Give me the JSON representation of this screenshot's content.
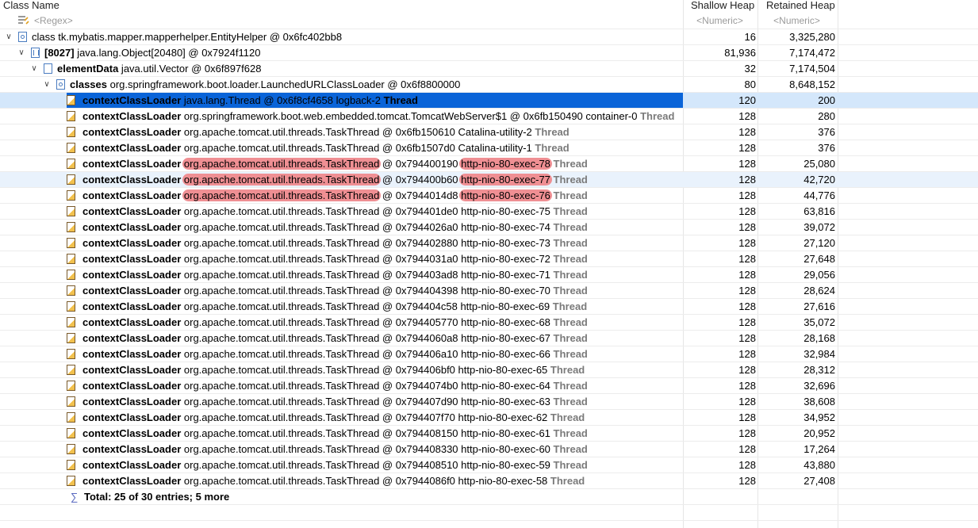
{
  "headers": {
    "class_name": "Class Name",
    "shallow_heap": "Shallow Heap",
    "retained_heap": "Retained Heap"
  },
  "filter": {
    "class_placeholder": "<Regex>",
    "shallow_placeholder": "<Numeric>",
    "retained_placeholder": "<Numeric>"
  },
  "tree": {
    "r1": {
      "name": "class tk.mybatis.mapper.mapperhelper.EntityHelper @ 0x6fc402bb8",
      "shallow": "16",
      "retained": "3,325,280"
    },
    "r2": {
      "prefix": "[8027]",
      "name": " java.lang.Object[20480] @ 0x7924f1120",
      "shallow": "81,936",
      "retained": "7,174,472"
    },
    "r3": {
      "field": "elementData",
      "name": " java.util.Vector @ 0x6f897f628",
      "shallow": "32",
      "retained": "7,174,504"
    },
    "r4": {
      "field": "classes",
      "name": " org.springframework.boot.loader.LaunchedURLClassLoader @ 0x6f8800000",
      "shallow": "80",
      "retained": "8,648,152"
    }
  },
  "field_label": "contextClassLoader",
  "thread_word": "Thread",
  "rows": [
    {
      "cls": "java.lang.Thread",
      "addr": " @ 0x6f8cf4658",
      "name": "  logback-2",
      "shallow": "120",
      "retained": "200"
    },
    {
      "cls": "org.springframework.boot.web.embedded.tomcat.TomcatWebServer$1",
      "addr": " @ 0x6fb150490",
      "name": "  container-0",
      "shallow": "128",
      "retained": "280"
    },
    {
      "cls": "org.apache.tomcat.util.threads.TaskThread",
      "addr": " @ 0x6fb150610",
      "name": "  Catalina-utility-2",
      "shallow": "128",
      "retained": "376"
    },
    {
      "cls": "org.apache.tomcat.util.threads.TaskThread",
      "addr": " @ 0x6fb1507d0",
      "name": "  Catalina-utility-1",
      "shallow": "128",
      "retained": "376"
    },
    {
      "cls": "org.apache.tomcat.util.threads.TaskThread",
      "addr": " @ 0x794400190",
      "name": "http-nio-80-exec-78",
      "shallow": "128",
      "retained": "25,080"
    },
    {
      "cls": "org.apache.tomcat.util.threads.TaskThread",
      "addr": " @ 0x794400b60",
      "name": "http-nio-80-exec-77",
      "shallow": "128",
      "retained": "42,720"
    },
    {
      "cls": "org.apache.tomcat.util.threads.TaskThread",
      "addr": " @ 0x7944014d8",
      "name": "http-nio-80-exec-76",
      "shallow": "128",
      "retained": "44,776"
    },
    {
      "cls": "org.apache.tomcat.util.threads.TaskThread",
      "addr": " @ 0x794401de0",
      "name": "  http-nio-80-exec-75",
      "shallow": "128",
      "retained": "63,816"
    },
    {
      "cls": "org.apache.tomcat.util.threads.TaskThread",
      "addr": " @ 0x7944026a0",
      "name": "  http-nio-80-exec-74",
      "shallow": "128",
      "retained": "39,072"
    },
    {
      "cls": "org.apache.tomcat.util.threads.TaskThread",
      "addr": " @ 0x794402880",
      "name": "  http-nio-80-exec-73",
      "shallow": "128",
      "retained": "27,120"
    },
    {
      "cls": "org.apache.tomcat.util.threads.TaskThread",
      "addr": " @ 0x7944031a0",
      "name": "  http-nio-80-exec-72",
      "shallow": "128",
      "retained": "27,648"
    },
    {
      "cls": "org.apache.tomcat.util.threads.TaskThread",
      "addr": " @ 0x794403ad8",
      "name": "  http-nio-80-exec-71",
      "shallow": "128",
      "retained": "29,056"
    },
    {
      "cls": "org.apache.tomcat.util.threads.TaskThread",
      "addr": " @ 0x794404398",
      "name": "  http-nio-80-exec-70",
      "shallow": "128",
      "retained": "28,624"
    },
    {
      "cls": "org.apache.tomcat.util.threads.TaskThread",
      "addr": " @ 0x794404c58",
      "name": "  http-nio-80-exec-69",
      "shallow": "128",
      "retained": "27,616"
    },
    {
      "cls": "org.apache.tomcat.util.threads.TaskThread",
      "addr": " @ 0x794405770",
      "name": "  http-nio-80-exec-68",
      "shallow": "128",
      "retained": "35,072"
    },
    {
      "cls": "org.apache.tomcat.util.threads.TaskThread",
      "addr": " @ 0x7944060a8",
      "name": "  http-nio-80-exec-67",
      "shallow": "128",
      "retained": "28,168"
    },
    {
      "cls": "org.apache.tomcat.util.threads.TaskThread",
      "addr": " @ 0x794406a10",
      "name": "  http-nio-80-exec-66",
      "shallow": "128",
      "retained": "32,984"
    },
    {
      "cls": "org.apache.tomcat.util.threads.TaskThread",
      "addr": " @ 0x794406bf0",
      "name": "  http-nio-80-exec-65",
      "shallow": "128",
      "retained": "28,312"
    },
    {
      "cls": "org.apache.tomcat.util.threads.TaskThread",
      "addr": " @ 0x7944074b0",
      "name": "  http-nio-80-exec-64",
      "shallow": "128",
      "retained": "32,696"
    },
    {
      "cls": "org.apache.tomcat.util.threads.TaskThread",
      "addr": " @ 0x794407d90",
      "name": "  http-nio-80-exec-63",
      "shallow": "128",
      "retained": "38,608"
    },
    {
      "cls": "org.apache.tomcat.util.threads.TaskThread",
      "addr": " @ 0x794407f70",
      "name": "  http-nio-80-exec-62",
      "shallow": "128",
      "retained": "34,952"
    },
    {
      "cls": "org.apache.tomcat.util.threads.TaskThread",
      "addr": " @ 0x794408150",
      "name": "  http-nio-80-exec-61",
      "shallow": "128",
      "retained": "20,952"
    },
    {
      "cls": "org.apache.tomcat.util.threads.TaskThread",
      "addr": " @ 0x794408330",
      "name": "  http-nio-80-exec-60",
      "shallow": "128",
      "retained": "17,264"
    },
    {
      "cls": "org.apache.tomcat.util.threads.TaskThread",
      "addr": " @ 0x794408510",
      "name": "  http-nio-80-exec-59",
      "shallow": "128",
      "retained": "43,880"
    },
    {
      "cls": "org.apache.tomcat.util.threads.TaskThread",
      "addr": " @ 0x7944086f0",
      "name": "  http-nio-80-exec-58",
      "shallow": "128",
      "retained": "27,408"
    }
  ],
  "highlighted_rows": [
    4,
    5,
    6
  ],
  "selected_row": 0,
  "hover_row": 5,
  "total": "Total: 25 of 30 entries; 5 more",
  "colors": {
    "selection": "#0a64d8",
    "highlight": "#ef8f93",
    "thread_word": "#7a7a7a"
  }
}
